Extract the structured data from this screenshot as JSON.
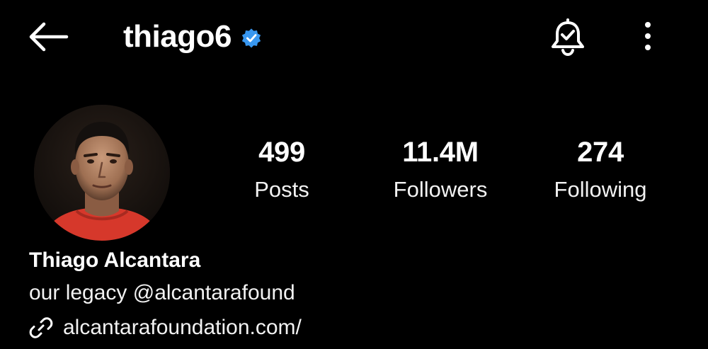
{
  "header": {
    "back_icon": "arrow-left-icon",
    "username": "thiago6",
    "verified_icon": "verified-badge-icon",
    "bell_icon": "bell-check-icon",
    "more_icon": "more-vertical-icon"
  },
  "profile": {
    "avatar": "profile-photo",
    "stats": [
      {
        "value": "499",
        "label": "Posts"
      },
      {
        "value": "11.4M",
        "label": "Followers"
      },
      {
        "value": "274",
        "label": "Following"
      }
    ],
    "display_name": "Thiago Alcantara",
    "bio_text": "our legacy ",
    "bio_mention": "@alcantarafound",
    "link_icon": "link-icon",
    "link": "alcantarafoundation.com/"
  },
  "colors": {
    "background": "#000000",
    "text": "#ffffff",
    "verified": "#3897f0"
  }
}
